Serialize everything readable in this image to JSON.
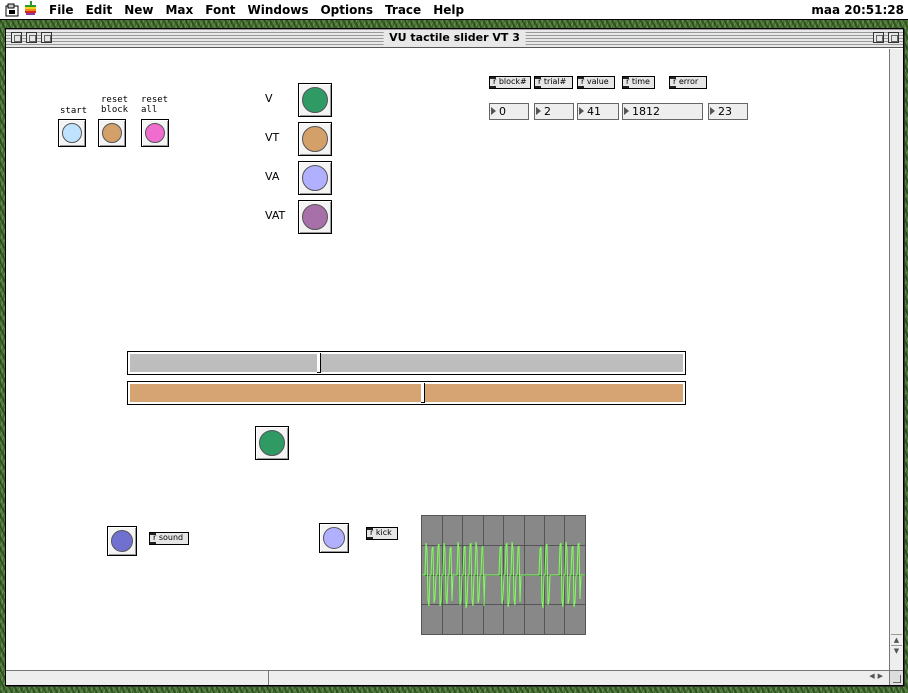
{
  "menubar": {
    "items": [
      "File",
      "Edit",
      "New",
      "Max",
      "Font",
      "Windows",
      "Options",
      "Trace",
      "Help"
    ],
    "clock": "maa 20:51:28"
  },
  "window": {
    "title": "VU tactile slider VT 3"
  },
  "controls": {
    "start_label": "start",
    "reset_block_label": "reset\nblock",
    "reset_all_label": "reset\nall"
  },
  "modes": [
    "V",
    "VT",
    "VA",
    "VAT"
  ],
  "receives": {
    "labels": [
      "r block#",
      "r trial#",
      "r value",
      "r time",
      "r error"
    ],
    "values": [
      "0",
      "2",
      "41",
      "1812",
      "23"
    ]
  },
  "sliders": {
    "top": {
      "level": 0.34
    },
    "bottom": {
      "level": 0.53
    }
  },
  "sound_receive": "r sound",
  "kick_receive": "r kick",
  "colors": {
    "start": "#bfe3ff",
    "reset_block": "#d4a06a",
    "reset_all": "#f06ccf",
    "v": "#2f9a63",
    "vt": "#d4a06a",
    "va": "#b0b0ff",
    "vat": "#a870a8",
    "indicator": "#2f9a63",
    "sound": "#7070d0",
    "kick": "#b0b0ff",
    "slider_top": "#bdbdbd",
    "slider_bottom": "#d6a373",
    "scope_trace": "#7dff5a"
  }
}
